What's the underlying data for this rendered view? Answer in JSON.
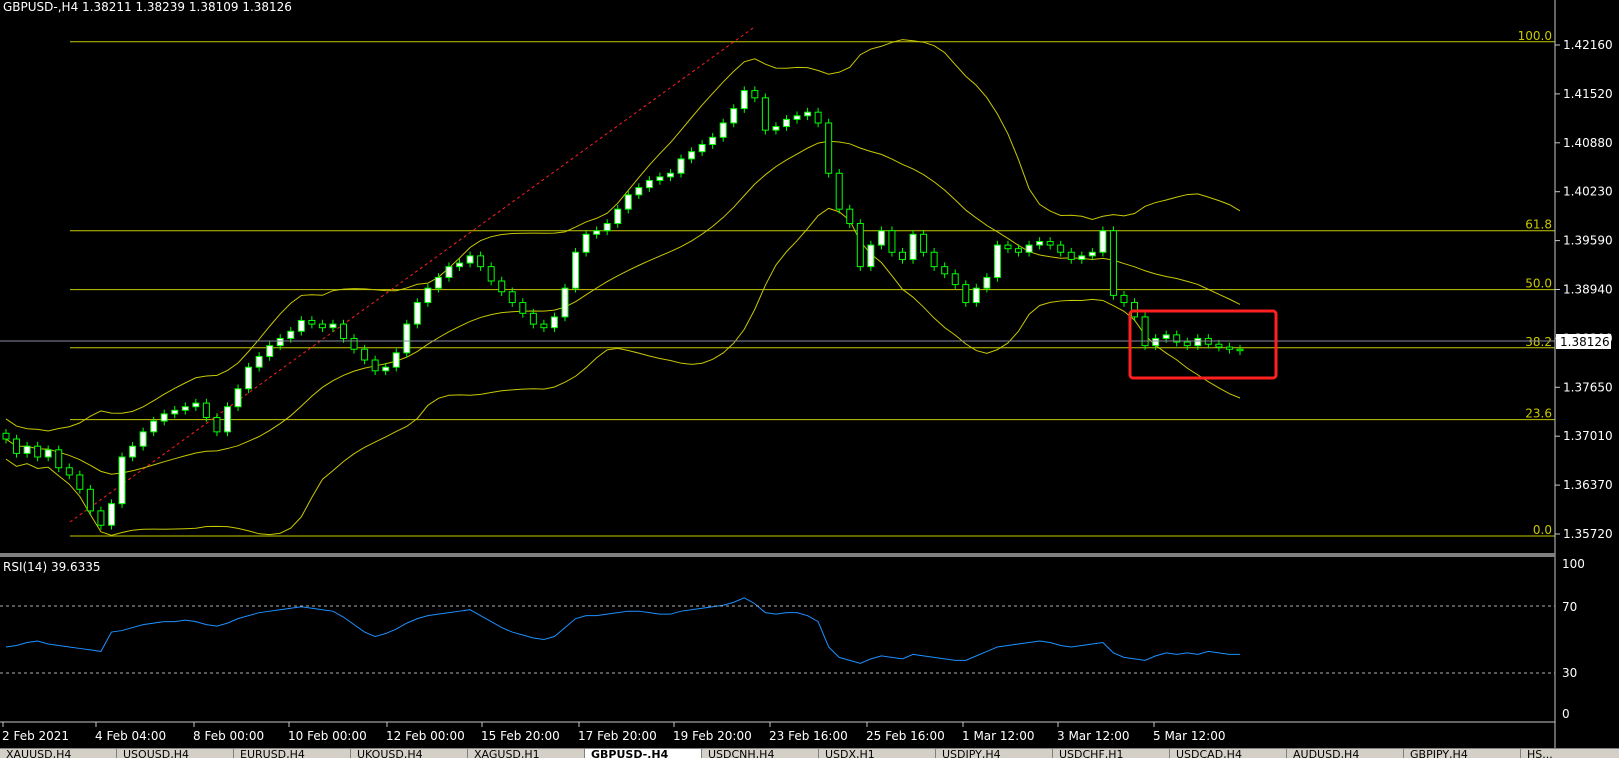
{
  "header": {
    "symbol": "GBPUSD-,H4",
    "ohlc": "1.38211 1.38239 1.38109 1.38126"
  },
  "rsi": {
    "label": "RSI(14) 39.6335",
    "levels": [
      "100",
      "70",
      "30",
      "0"
    ]
  },
  "current_price": "1.38126",
  "colors": {
    "bg": "#000000",
    "bull": "#ffffff",
    "bear": "#000000",
    "wick": "#00ff00",
    "fib": "#c8c800",
    "bands": "#c8c800",
    "rsi": "#1e90ff",
    "highlight": "#ff2020",
    "trend": "#ff2020"
  },
  "tabs": [
    "XAUUSD,H4",
    "USOUSD,H4",
    "EURUSD,H4",
    "UKOUSD,H4",
    "XAGUSD,H1",
    "GBPUSD-,H4",
    "USDCNH,H4",
    "USDX,H1",
    "USDJPY,H4",
    "USDCHF,H1",
    "USDCAD,H4",
    "AUDUSD,H4",
    "GBPJPY,H4",
    "HS..."
  ],
  "active_tab": 5,
  "chart_data": {
    "type": "candlestick",
    "price_axis_ticks": [
      "1.42160",
      "1.41520",
      "1.40880",
      "1.40230",
      "1.39590",
      "1.38940",
      "1.38300",
      "1.37650",
      "1.37010",
      "1.36370",
      "1.35720"
    ],
    "time_axis_labels": [
      "2 Feb 2021",
      "4 Feb 04:00",
      "8 Feb 00:00",
      "10 Feb 00:00",
      "12 Feb 00:00",
      "15 Feb 20:00",
      "17 Feb 20:00",
      "19 Feb 20:00",
      "23 Feb 16:00",
      "25 Feb 16:00",
      "1 Mar 12:00",
      "3 Mar 12:00",
      "5 Mar 12:00"
    ],
    "ylim": [
      1.3555,
      1.4265
    ],
    "fib_levels": [
      {
        "label": "100.0",
        "price": 1.4243
      },
      {
        "label": "61.8",
        "price": 1.398
      },
      {
        "label": "50.0",
        "price": 1.3898
      },
      {
        "label": "38.2",
        "price": 1.3817
      },
      {
        "label": "23.6",
        "price": 1.3717
      },
      {
        "label": "0.0",
        "price": 1.3555
      }
    ],
    "closes": [
      1.369,
      1.367,
      1.368,
      1.3665,
      1.3675,
      1.365,
      1.364,
      1.362,
      1.359,
      1.357,
      1.36,
      1.3665,
      1.368,
      1.37,
      1.3715,
      1.3725,
      1.373,
      1.3735,
      1.374,
      1.372,
      1.37,
      1.3735,
      1.376,
      1.379,
      1.3805,
      1.382,
      1.383,
      1.384,
      1.3855,
      1.385,
      1.3845,
      1.385,
      1.383,
      1.3815,
      1.38,
      1.3785,
      1.379,
      1.381,
      1.385,
      1.388,
      1.39,
      1.3915,
      1.393,
      1.3935,
      1.3945,
      1.393,
      1.391,
      1.3895,
      1.388,
      1.3865,
      1.385,
      1.3845,
      1.386,
      1.39,
      1.395,
      1.3975,
      1.398,
      1.399,
      1.401,
      1.403,
      1.404,
      1.405,
      1.4055,
      1.406,
      1.408,
      1.409,
      1.41,
      1.411,
      1.413,
      1.415,
      1.4175,
      1.4165,
      1.412,
      1.4125,
      1.4135,
      1.414,
      1.4145,
      1.413,
      1.406,
      1.401,
      1.399,
      1.393,
      1.396,
      1.398,
      1.395,
      1.394,
      1.3975,
      1.395,
      1.393,
      1.392,
      1.3905,
      1.388,
      1.39,
      1.3915,
      1.396,
      1.3955,
      1.395,
      1.396,
      1.3965,
      1.396,
      1.395,
      1.394,
      1.3945,
      1.395,
      1.398,
      1.389,
      1.388,
      1.386,
      1.382,
      1.383,
      1.3835,
      1.3825,
      1.382,
      1.383,
      1.3822,
      1.3818,
      1.3815,
      1.3813
    ],
    "rsi_values": [
      45,
      46,
      48,
      49,
      47,
      46,
      45,
      44,
      43,
      42,
      55,
      56,
      58,
      60,
      61,
      62,
      62,
      63,
      62,
      60,
      59,
      61,
      64,
      66,
      68,
      69,
      70,
      71,
      72,
      71,
      70,
      69,
      65,
      60,
      55,
      52,
      54,
      57,
      61,
      64,
      66,
      67,
      68,
      69,
      70,
      66,
      62,
      58,
      55,
      53,
      51,
      50,
      52,
      58,
      64,
      66,
      66,
      67,
      68,
      69,
      69,
      68,
      67,
      67,
      69,
      70,
      71,
      72,
      73,
      75,
      78,
      74,
      68,
      67,
      68,
      68,
      66,
      62,
      45,
      38,
      36,
      34,
      37,
      39,
      38,
      37,
      40,
      39,
      38,
      37,
      36,
      36,
      39,
      42,
      45,
      46,
      47,
      48,
      49,
      48,
      46,
      45,
      46,
      47,
      48,
      41,
      38,
      37,
      36,
      39,
      41,
      40,
      41,
      40,
      42,
      41,
      40,
      40
    ]
  }
}
